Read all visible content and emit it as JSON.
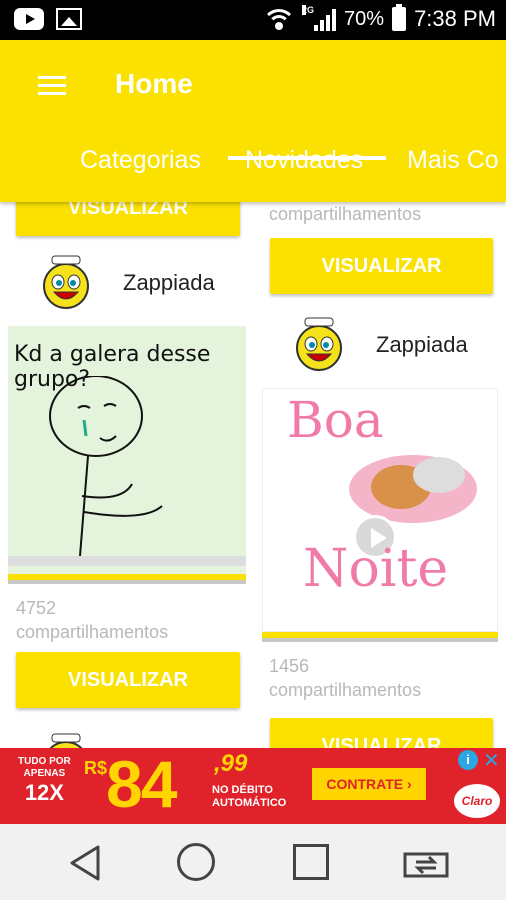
{
  "status_bar": {
    "network_type": "2G",
    "battery": "70%",
    "time": "7:38 PM"
  },
  "app_bar": {
    "title": "Home",
    "tabs": [
      {
        "label": "Categorias"
      },
      {
        "label": "Novidades",
        "selected": true
      },
      {
        "label": "Mais Co"
      }
    ]
  },
  "feed": {
    "button_label": "VISUALIZAR",
    "share_suffix": "compartilhamentos",
    "left_column": {
      "top_button": "VISUALIZAR",
      "post": {
        "user": "Zappiada",
        "image_caption": "Kd a galera desse grupo?",
        "shares": "4752",
        "button": "VISUALIZAR"
      }
    },
    "right_column": {
      "top_shares_text": "compartilhamentos",
      "top_button": "VISUALIZAR",
      "post": {
        "user": "Zappiada",
        "image_line1": "Boa",
        "image_line2": "Noite",
        "shares": "1456",
        "button": "VISUALIZAR"
      }
    }
  },
  "ad": {
    "promo_line1": "TUDO POR",
    "promo_line2": "APENAS",
    "promo_installments": "12X",
    "currency": "R$",
    "price": "84",
    "cents": ",99",
    "payment_line1": "NO DÉBITO",
    "payment_line2": "AUTOMÁTICO",
    "cta": "CONTRATE",
    "brand": "Claro"
  },
  "colors": {
    "accent": "#fae100",
    "status_bar": "#000000",
    "ad_red": "#e0222a",
    "muted_text": "#b8b8b8"
  },
  "icons": {
    "menu": "hamburger-menu-icon",
    "nav_back": "back-triangle-icon",
    "nav_home": "home-circle-icon",
    "nav_recent": "recent-apps-square-icon",
    "nav_switch": "switch-apps-icon"
  }
}
